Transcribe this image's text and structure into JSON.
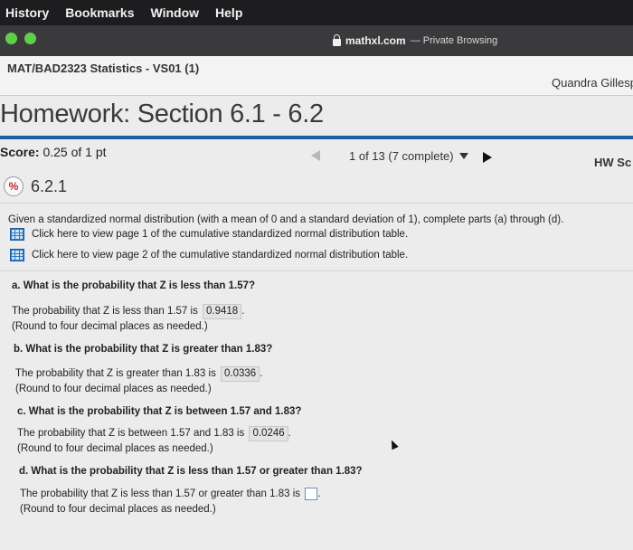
{
  "menubar": {
    "items": [
      "History",
      "Bookmarks",
      "Window",
      "Help"
    ]
  },
  "browser": {
    "domain": "mathxl.com",
    "mode": "— Private Browsing"
  },
  "course": {
    "title": "MAT/BAD2323 Statistics - VS01 (1)",
    "user": "Quandra Gillesp"
  },
  "homework": {
    "title": "Homework: Section 6.1 - 6.2"
  },
  "score": {
    "label": "Score:",
    "value": "0.25 of 1 pt"
  },
  "progress": {
    "text": "1 of 13 (7 complete)"
  },
  "hw_score_label": "HW Sc",
  "question": {
    "status": "%",
    "number": "6.2.1"
  },
  "intro": "Given a standardized normal distribution (with a mean of 0 and a standard deviation of 1), complete parts (a) through (d).",
  "links": [
    "Click here to view page 1 of the cumulative standardized normal distribution table.",
    "Click here to view page 2 of the cumulative standardized normal distribution table."
  ],
  "parts": {
    "a": {
      "question": "a. What is the probability that Z is less than 1.57?",
      "answer_prefix": "The probability that Z is less than 1.57 is",
      "answer": "0.9418",
      "round_note": "(Round to four decimal places as needed.)"
    },
    "b": {
      "question": "b. What is the probability that Z is greater than 1.83?",
      "answer_prefix": "The probability that Z is greater than 1.83 is",
      "answer": "0.0336",
      "round_note": "(Round to four decimal places as needed.)"
    },
    "c": {
      "question": "c. What is the probability that Z is between 1.57 and 1.83?",
      "answer_prefix": "The probability that Z is between 1.57 and 1.83 is",
      "answer": "0.0246",
      "round_note": "(Round to four decimal places as needed.)"
    },
    "d": {
      "question": "d. What is the probability that Z is less than 1.57 or greater than 1.83?",
      "answer_prefix": "The probability that Z is less than 1.57 or greater than 1.83 is",
      "answer": "",
      "round_note": "(Round to four decimal places as needed.)"
    }
  },
  "colors": {
    "accent": "#1f5fa0",
    "menubar": "#1d1d1f",
    "titlebar": "#3a3a3c",
    "status_wrong": "#c3262e"
  },
  "icons": [
    "lock-icon",
    "table-icon",
    "caret-down-icon",
    "prev-arrow-icon",
    "next-arrow-icon",
    "partial-credit-icon"
  ]
}
